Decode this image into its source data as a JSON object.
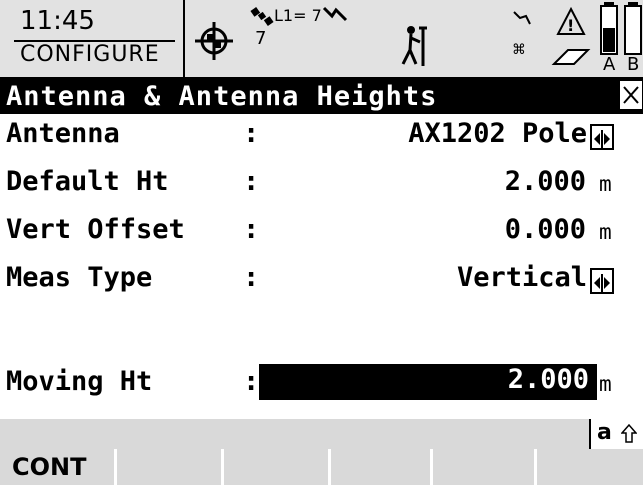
{
  "status": {
    "time": "11:45",
    "mode": "CONFIGURE",
    "gps_label": "L1= 7",
    "gps_count": "7",
    "battery_a": "A",
    "battery_b": "B"
  },
  "window": {
    "title": "Antenna & Antenna Heights"
  },
  "fields": [
    {
      "label": "Antenna",
      "value": "AX1202 Pole",
      "unit": ""
    },
    {
      "label": "Default Ht",
      "value": "2.000",
      "unit": "m"
    },
    {
      "label": "Vert Offset",
      "value": "0.000",
      "unit": "m"
    },
    {
      "label": "Meas Type",
      "value": "Vertical",
      "unit": ""
    },
    {
      "label": "Moving Ht",
      "value": "2.000",
      "unit": "m"
    }
  ],
  "separator": ":",
  "input_mode": "a",
  "softkeys": [
    "CONT",
    "",
    "",
    "",
    "",
    ""
  ]
}
